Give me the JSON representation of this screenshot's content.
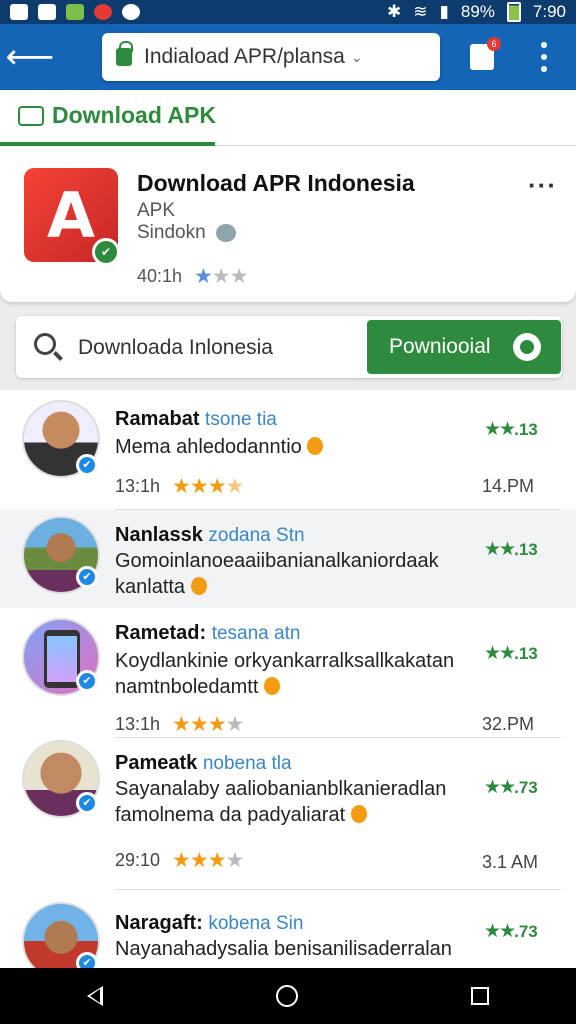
{
  "status_bar": {
    "battery": "89%",
    "time": "7:90"
  },
  "app_bar": {
    "url": "Indiaload APR/plansa"
  },
  "notif_count": "6",
  "tab": {
    "label": "Download APK"
  },
  "app": {
    "title": "Download APR Indonesia",
    "subtitle": "APK",
    "developer": "Sindokn",
    "meta": "40:1h",
    "logo_letter": "A",
    "rating_stars": 3
  },
  "search": {
    "text": "Downloada Inlonesia",
    "button": "Powniooial"
  },
  "items": [
    {
      "name": "Ramabat",
      "tag": "tsone tia",
      "message": "Mema ahledodanntio",
      "score": "13",
      "time": "13:1h",
      "timestamp": "14.PM",
      "stars": 3.5
    },
    {
      "name": "Nanlassk",
      "tag": "zodana Stn",
      "message": "Gomoinlanoeaaiibanianalkaniordaak kanlatta",
      "score": "13",
      "time": "",
      "timestamp": "",
      "stars": 0
    },
    {
      "name": "Rametad:",
      "tag": "tesana atn",
      "message": "Koydlankinie orkyankarralksallkakatan namtnboledamtt",
      "score": "13",
      "time": "13:1h",
      "timestamp": "32.PM",
      "stars": 3
    },
    {
      "name": "Pameatk",
      "tag": "nobena tla",
      "message": "Sayanalaby aaliobanianblkanieradlan famolnema da padyaliarat",
      "score": "73",
      "time": "29:10",
      "timestamp": "3.1 AM",
      "stars": 3
    },
    {
      "name": "Naragaft:",
      "tag": "kobena Sin",
      "message": "Nayanahadysalia benisanilisaderralan",
      "score": "73",
      "time": "",
      "timestamp": "",
      "stars": 0
    }
  ]
}
